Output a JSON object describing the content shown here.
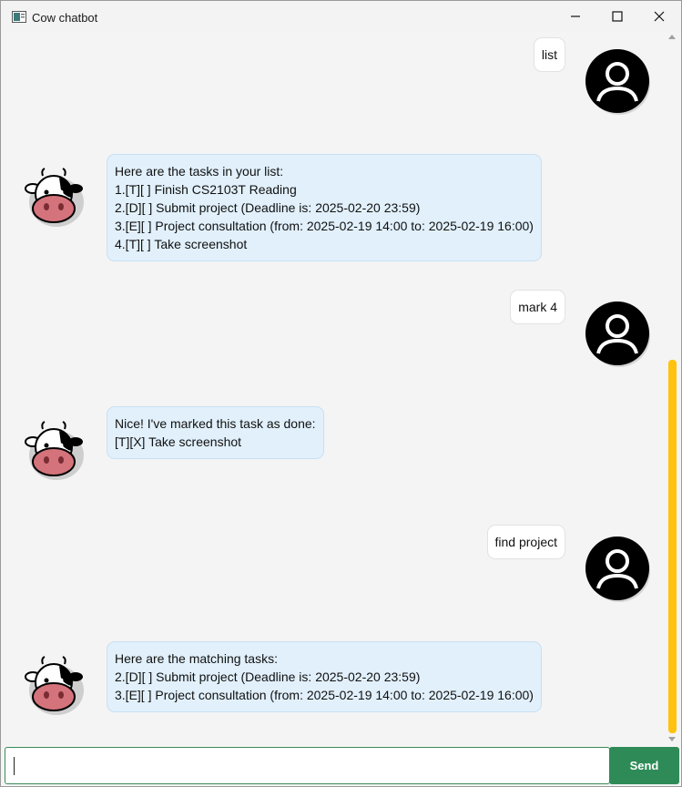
{
  "window": {
    "title": "Cow chatbot"
  },
  "messages": [
    {
      "sender": "user",
      "lines": [
        "list"
      ]
    },
    {
      "sender": "bot",
      "lines": [
        "Here are the tasks in your list:",
        "1.[T][ ] Finish CS2103T Reading",
        "2.[D][ ] Submit project (Deadline is: 2025-02-20 23:59)",
        "3.[E][ ] Project consultation (from: 2025-02-19 14:00 to: 2025-02-19 16:00)",
        "4.[T][ ] Take screenshot"
      ]
    },
    {
      "sender": "user",
      "lines": [
        "mark 4"
      ]
    },
    {
      "sender": "bot",
      "lines": [
        "Nice! I've marked this task as done:",
        "[T][X] Take screenshot"
      ]
    },
    {
      "sender": "user",
      "lines": [
        "find project"
      ]
    },
    {
      "sender": "bot",
      "lines": [
        "Here are the matching tasks:",
        "2.[D][ ] Submit project (Deadline is: 2025-02-20 23:59)",
        "3.[E][ ] Project consultation (from: 2025-02-19 14:00 to: 2025-02-19 16:00)"
      ]
    }
  ],
  "input": {
    "value": "",
    "placeholder": ""
  },
  "send_button": {
    "label": "Send"
  },
  "colors": {
    "accent": "#2e8b57",
    "scroll_thumb": "#ffc20e",
    "bot_bubble": "#e1f0fb"
  },
  "icons": {
    "user_avatar": "person-icon",
    "bot_avatar": "cow-icon"
  }
}
